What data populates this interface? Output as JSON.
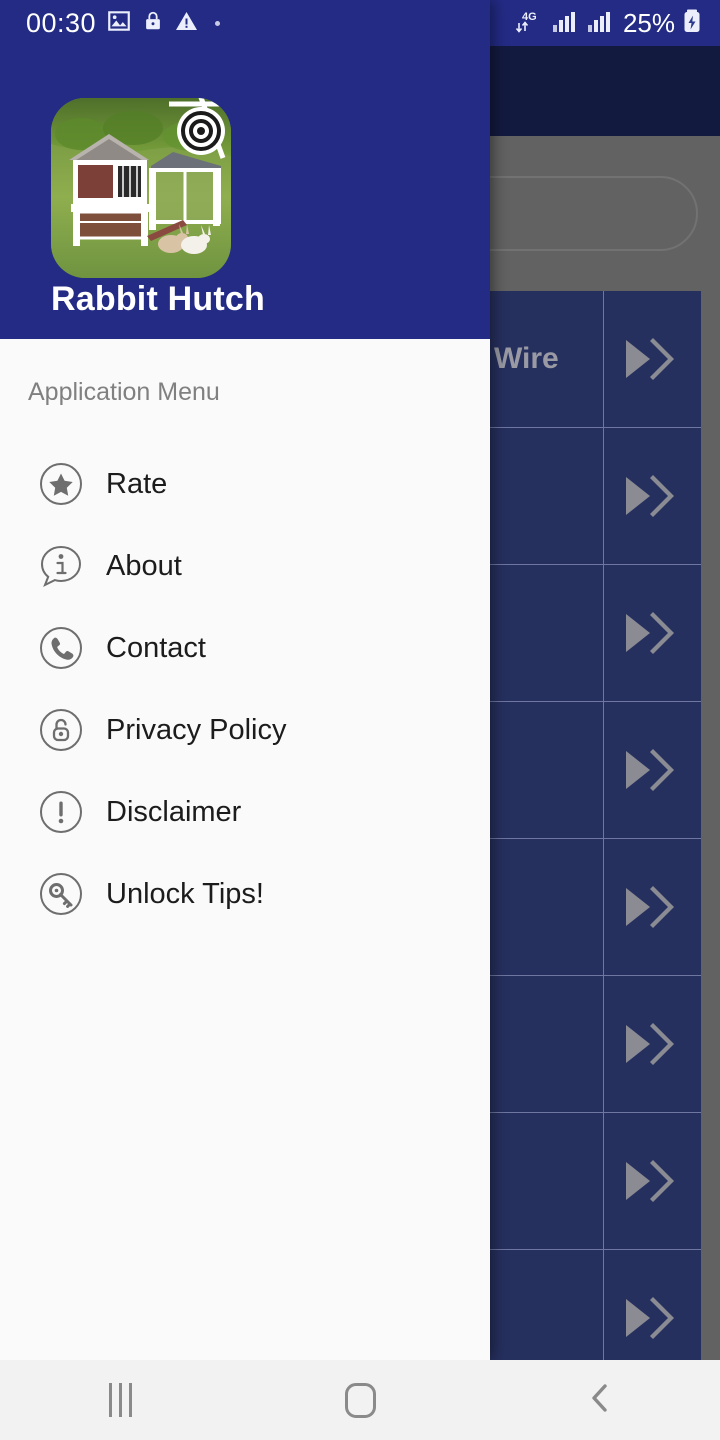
{
  "status_bar": {
    "time": "00:30",
    "left_icons": [
      "image-icon",
      "lock-icon",
      "warning-icon",
      "dot-indicator"
    ],
    "network_type": "4G",
    "signal_icons": [
      "signal-bars-sim1",
      "signal-bars-sim2"
    ],
    "battery_percent": "25%",
    "battery_state": "charging",
    "background_color": "#232b85",
    "text_color": "#ffffff"
  },
  "drawer": {
    "app_title": "Rabbit Hutch",
    "app_icon_name": "rabbit-hutch-app-icon",
    "header_color": "#232b85",
    "body_color": "#fafafa",
    "menu_header": "Application Menu",
    "items": [
      {
        "label": "Rate",
        "icon": "star-circle-icon"
      },
      {
        "label": "About",
        "icon": "info-bubble-icon"
      },
      {
        "label": "Contact",
        "icon": "phone-circle-icon"
      },
      {
        "label": "Privacy Policy",
        "icon": "padlock-circle-icon"
      },
      {
        "label": "Disclaimer",
        "icon": "exclamation-circle-icon"
      },
      {
        "label": "Unlock Tips!",
        "icon": "key-circle-icon"
      }
    ]
  },
  "background_app": {
    "toolbar_color": "#131a40",
    "search_area_color": "#626262",
    "row_color": "#26305f",
    "row_text_color": "#9a9aa4",
    "rows": [
      {
        "label": "Wire",
        "chevron": "double-chevron-right-icon"
      },
      {
        "label": "",
        "chevron": "double-chevron-right-icon"
      },
      {
        "label": "",
        "chevron": "double-chevron-right-icon"
      },
      {
        "label": "",
        "chevron": "double-chevron-right-icon"
      },
      {
        "label": "",
        "chevron": "double-chevron-right-icon"
      },
      {
        "label": "",
        "chevron": "double-chevron-right-icon"
      },
      {
        "label": "",
        "chevron": "double-chevron-right-icon"
      },
      {
        "label": "",
        "chevron": "double-chevron-right-icon"
      }
    ]
  },
  "navigation_bar": {
    "background_color": "#f2f2f2",
    "buttons": [
      {
        "name": "recents",
        "icon": "recents-icon"
      },
      {
        "name": "home",
        "icon": "home-square-icon"
      },
      {
        "name": "back",
        "icon": "back-chevron-icon"
      }
    ]
  }
}
